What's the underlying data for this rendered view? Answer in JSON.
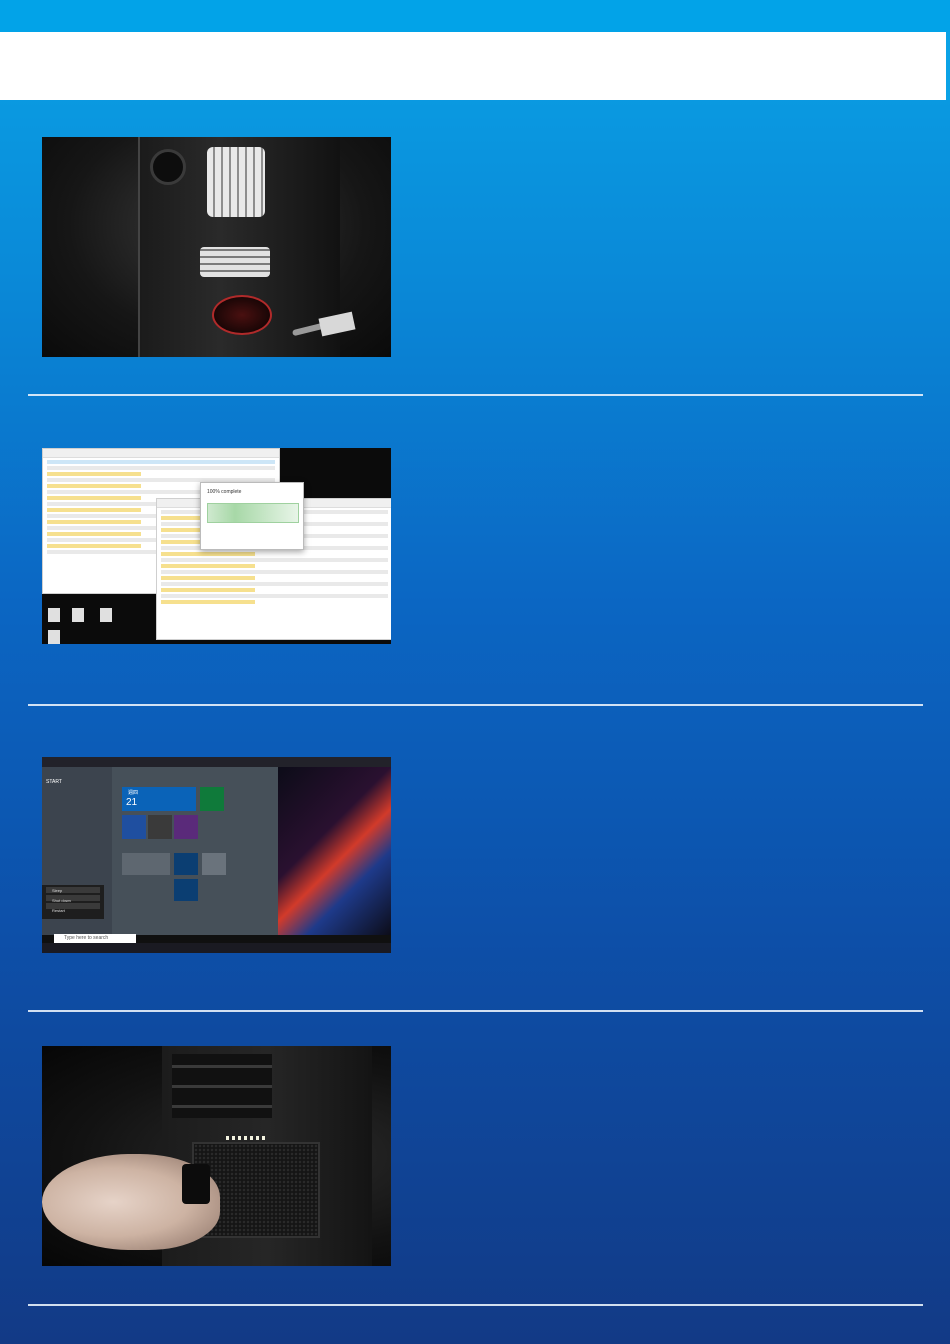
{
  "colors": {
    "top_bar": "#02a3e8",
    "header_box": "#ffffff",
    "background_gradient_top": "#0aa2e6",
    "background_gradient_bottom": "#123a86",
    "divider": "#e8f1fb"
  },
  "steps": [
    {
      "image": "pc-case-interior-photo",
      "text": ""
    },
    {
      "image": "file-explorer-copy-screenshot",
      "text": ""
    },
    {
      "image": "start-menu-power-screenshot",
      "text": ""
    },
    {
      "image": "psu-power-switch-photo",
      "text": ""
    }
  ],
  "screenshot2": {
    "copy_dialog_title": "100% complete"
  },
  "screenshot3": {
    "menu_title": "START",
    "date_number": "21",
    "date_day": "週四",
    "search_placeholder": "Type here to search",
    "power_items": [
      "Sleep",
      "Shut down",
      "Restart"
    ]
  }
}
